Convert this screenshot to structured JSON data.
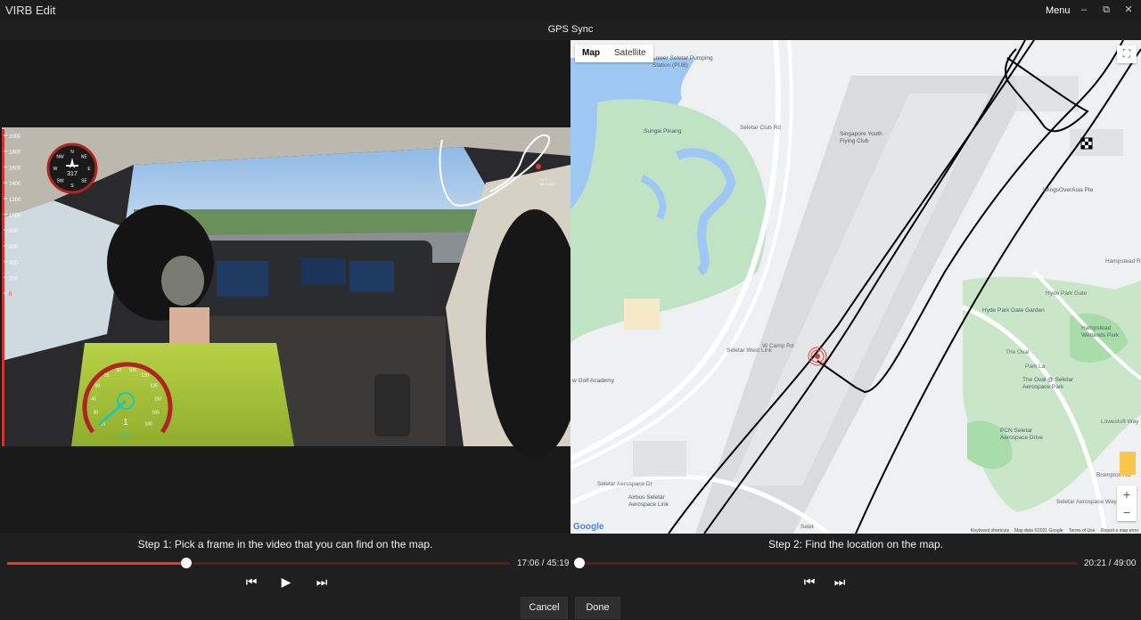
{
  "app": {
    "title": "VIRB Edit",
    "menu_label": "Menu"
  },
  "window": {
    "minimize": "–",
    "restore": "⧉",
    "close": "✕"
  },
  "header": {
    "subtitle": "GPS Sync"
  },
  "video": {
    "altitude_ticks": [
      "2000",
      "1800",
      "1600",
      "1400",
      "1200",
      "1000",
      "800",
      "600",
      "400",
      "200",
      "0"
    ],
    "compass": {
      "letters": [
        "N",
        "NE",
        "E",
        "SE",
        "S",
        "SW",
        "W",
        "NW"
      ],
      "heading": "317"
    },
    "speed": {
      "ticks": [
        "15",
        "30",
        "45",
        "60",
        "75",
        "90",
        "105",
        "120",
        "135",
        "150",
        "165",
        "180"
      ],
      "value": "1",
      "unit": "KT"
    },
    "track_label": [
      "1 KT",
      "65.0 MM"
    ]
  },
  "map": {
    "type_toggle": {
      "map": "Map",
      "satellite": "Satellite",
      "active": "Map"
    },
    "labels": [
      "Lower Seletar Pumping\nStation (PUB)",
      "Sungai Pinang",
      "Singapore Youth\nFlying Club",
      "WingsOverAsia Pte",
      "Hyde Park Gate Garden",
      "Hampstead\nWetlands Park",
      "The Oval @ Seletar\nAerospace Park",
      "PCN Seletar\nAerospace Drive",
      "Airbus Seletar\nAerospace Link",
      "w Golf Academy",
      "Seletar West Link",
      "W Camp Rd",
      "Seletar Club Rd",
      "Seletar Aerospace Dr",
      "Hyde Park Gate",
      "Park La",
      "The Oval",
      "Hampstead Rd",
      "Seletar Aerospace Way",
      "Brompton Rd",
      "Lowestoft Way",
      "Selet"
    ],
    "google_logo": "Google",
    "attribution": {
      "shortcuts": "Keyboard shortcuts",
      "data": "Map data ©2021 Google",
      "terms": "Terms of Use",
      "report": "Report a map error"
    },
    "zoom_in": "+",
    "zoom_out": "−"
  },
  "left_player": {
    "instruction": "Step 1: Pick a frame in the video that you can find on the map.",
    "time": "17:06 / 45:19",
    "progress": 0.3567,
    "accent": "#e2401c"
  },
  "right_player": {
    "instruction": "Step 2: Find the location on the map.",
    "time": "20:21 / 49:00",
    "progress": 0.0,
    "accent": "#c0392b"
  },
  "footer": {
    "cancel": "Cancel",
    "done": "Done"
  }
}
